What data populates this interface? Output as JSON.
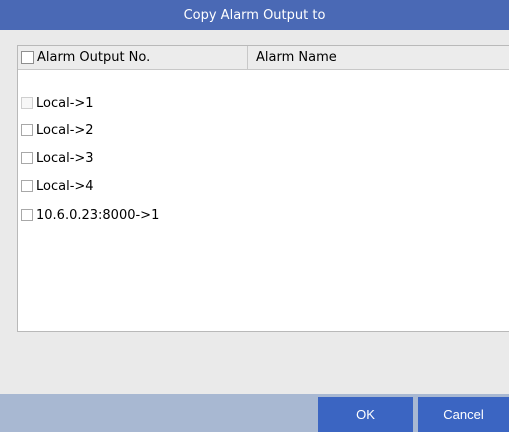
{
  "dialog": {
    "title": "Copy Alarm Output to"
  },
  "table": {
    "columns": [
      "Alarm Output No.",
      "Alarm Name"
    ],
    "rows": [
      {
        "label": "Local->1",
        "name": ""
      },
      {
        "label": "Local->2",
        "name": ""
      },
      {
        "label": "Local->3",
        "name": ""
      },
      {
        "label": "Local->4",
        "name": ""
      },
      {
        "label": "10.6.0.23:8000->1",
        "name": ""
      }
    ]
  },
  "buttons": {
    "ok": "OK",
    "cancel": "Cancel"
  },
  "colors": {
    "titlebar": "#4a69b5",
    "footer": "#a8b8d2",
    "button": "#3b65c2",
    "panel": "#eaeaea"
  }
}
